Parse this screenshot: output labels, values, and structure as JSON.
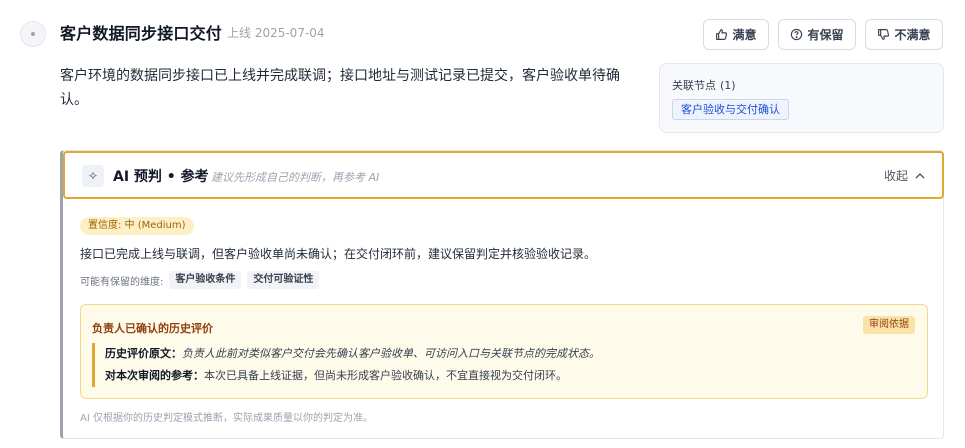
{
  "header": {
    "title": "客户数据同步接口交付",
    "date": "上线 2025-07-04"
  },
  "actions": {
    "satisfied": "满意",
    "reserved": "有保留",
    "dissatisfied": "不满意"
  },
  "description": "客户环境的数据同步接口已上线并完成联调；接口地址与测试记录已提交，客户验收单待确认。",
  "related": {
    "title": "关联节点",
    "count": "(1)",
    "tag": "客户验收与交付确认"
  },
  "ai": {
    "title": "AI 预判 • 参考",
    "hint": "建议先形成自己的判断，再参考 AI",
    "collapse": "收起",
    "confidence": "置信度: 中 (Medium)",
    "summary": "接口已完成上线与联调，但客户验收单尚未确认；在交付闭环前，建议保留判定并核验验收记录。",
    "dims_label": "可能有保留的维度:",
    "dims": [
      "客户验收条件",
      "交付可验证性"
    ],
    "history": {
      "title": "负责人已确认的历史评价",
      "badge": "审阅依据",
      "original_label": "历史评价原文：",
      "original_text": "负责人此前对类似客户交付会先确认客户验收单、可访问入口与关联节点的完成状态。",
      "reference_label": "对本次审阅的参考：",
      "reference_text": "本次已具备上线证据，但尚未形成客户验收确认，不宜直接视为交付闭环。"
    },
    "footnote": "AI 仅根据你的历史判定模式推断，实际成果质量以你的判定为准。"
  }
}
